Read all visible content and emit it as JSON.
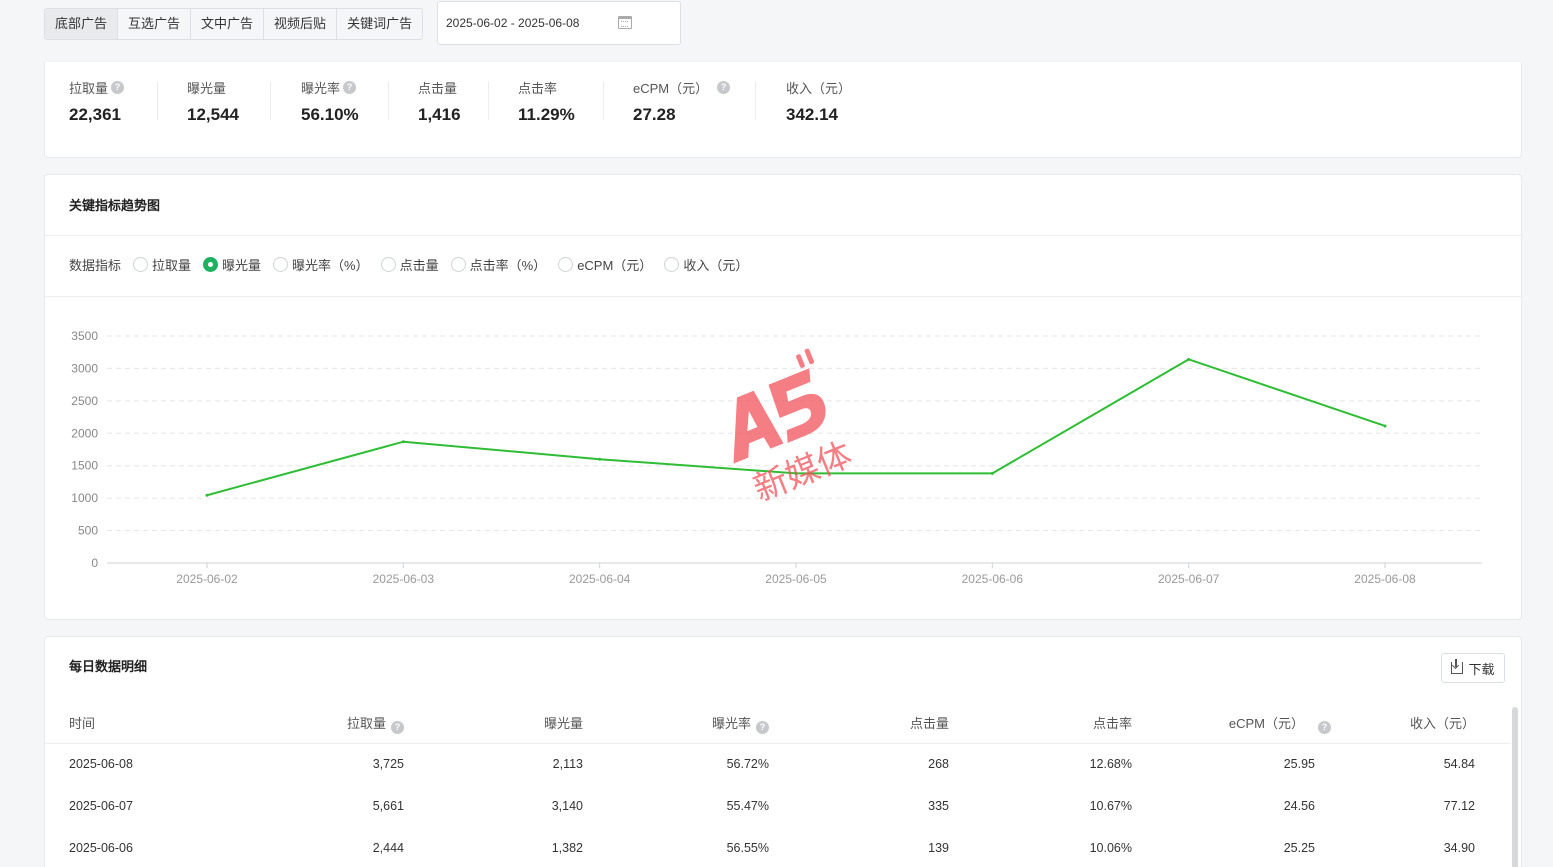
{
  "tabs": [
    "底部广告",
    "互选广告",
    "文中广告",
    "视频后贴",
    "关键词广告"
  ],
  "date_range": "2025-06-02 - 2025-06-08",
  "kpis": [
    {
      "label": "拉取量",
      "value": "22,361",
      "help": true
    },
    {
      "label": "曝光量",
      "value": "12,544",
      "help": false
    },
    {
      "label": "曝光率",
      "value": "56.10%",
      "help": true
    },
    {
      "label": "点击量",
      "value": "1,416",
      "help": false
    },
    {
      "label": "点击率",
      "value": "11.29%",
      "help": false
    },
    {
      "label": "eCPM（元）",
      "value": "27.28",
      "help": true
    },
    {
      "label": "收入（元）",
      "value": "342.14",
      "help": false
    }
  ],
  "trend": {
    "title": "关键指标趋势图",
    "metric_label": "数据指标",
    "options": [
      "拉取量",
      "曝光量",
      "曝光率（%）",
      "点击量",
      "点击率（%）",
      "eCPM（元）",
      "收入（元）"
    ],
    "selected": "曝光量"
  },
  "chart_data": {
    "type": "line",
    "x": [
      "2025-06-02",
      "2025-06-03",
      "2025-06-04",
      "2025-06-05",
      "2025-06-06",
      "2025-06-07",
      "2025-06-08"
    ],
    "series": [
      {
        "values": [
          1045,
          1870,
          1600,
          1382,
          1382,
          3140,
          2113
        ]
      }
    ],
    "yticks": [
      0,
      500,
      1000,
      1500,
      2000,
      2500,
      3000,
      3500
    ],
    "ylim": [
      0,
      3500
    ],
    "grid": true,
    "color": "#2ebd34"
  },
  "table": {
    "title": "每日数据明细",
    "download_label": "下载",
    "columns": [
      "时间",
      "拉取量",
      "曝光量",
      "曝光率",
      "点击量",
      "点击率",
      "eCPM（元）",
      "收入（元）"
    ],
    "rows": [
      [
        "2025-06-08",
        "3,725",
        "2,113",
        "56.72%",
        "268",
        "12.68%",
        "25.95",
        "54.84"
      ],
      [
        "2025-06-07",
        "5,661",
        "3,140",
        "55.47%",
        "335",
        "10.67%",
        "24.56",
        "77.12"
      ],
      [
        "2025-06-06",
        "2,444",
        "1,382",
        "56.55%",
        "139",
        "10.06%",
        "25.25",
        "34.90"
      ]
    ]
  },
  "colors": {
    "accent": "#1eb15f",
    "line": "#2ebd34",
    "watermark": "#f2535b"
  }
}
